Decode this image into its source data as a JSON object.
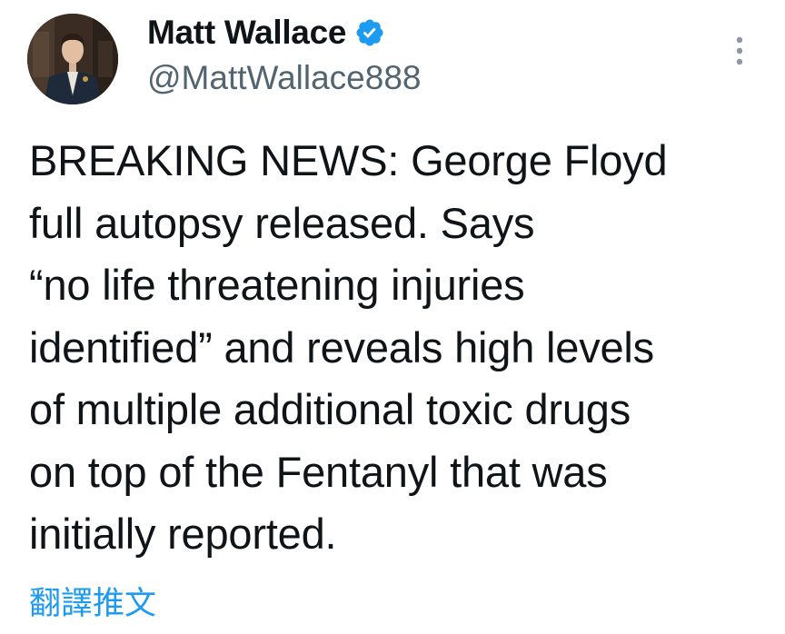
{
  "author": {
    "display_name": "Matt Wallace",
    "handle": "@MattWallace888",
    "verified": true
  },
  "tweet": {
    "lines": [
      "BREAKING NEWS: George Floyd",
      "full autopsy released. Says",
      "“no life threatening injuries",
      "identified” and reveals high levels",
      "of multiple additional toxic drugs",
      "on top of the Fentanyl that was",
      "initially reported."
    ]
  },
  "translate_label": "翻譯推文",
  "icons": {
    "verified": "verified-badge-icon",
    "more": "more-options-icon"
  },
  "colors": {
    "accent": "#1d9bf0",
    "text": "#0f1419",
    "secondary": "#536471"
  }
}
